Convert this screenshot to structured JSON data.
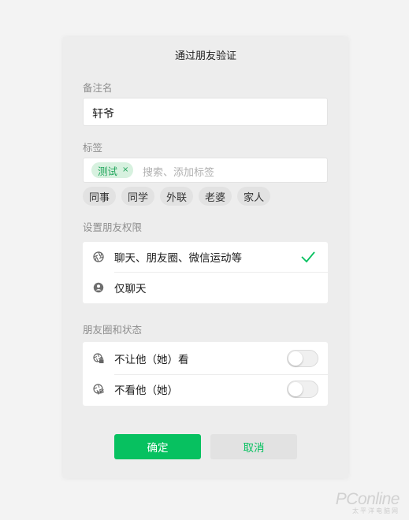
{
  "dialog": {
    "title": "通过朋友验证",
    "remark": {
      "label": "备注名",
      "value": "轩爷"
    },
    "tags": {
      "label": "标签",
      "selected": [
        {
          "text": "测试",
          "remove": "×"
        }
      ],
      "placeholder": "搜索、添加标签",
      "suggestions": [
        "同事",
        "同学",
        "外联",
        "老婆",
        "家人"
      ]
    },
    "permissions": {
      "label": "设置朋友权限",
      "options": [
        {
          "text": "聊天、朋友圈、微信运动等",
          "icon": "aperture-icon",
          "selected": true
        },
        {
          "text": "仅聊天",
          "icon": "chat-bubble-icon",
          "selected": false
        }
      ]
    },
    "moments": {
      "label": "朋友圈和状态",
      "options": [
        {
          "text": "不让他（她）看",
          "icon": "lock-aperture-icon",
          "enabled": false
        },
        {
          "text": "不看他（她）",
          "icon": "eye-slash-icon",
          "enabled": false
        }
      ]
    },
    "buttons": {
      "confirm": "确定",
      "cancel": "取消"
    }
  },
  "watermark": {
    "main": "PConline",
    "sub": "太平洋电脑网"
  },
  "colors": {
    "accent": "#07c160",
    "background": "#f3f3f3",
    "dialog": "#ededed"
  }
}
